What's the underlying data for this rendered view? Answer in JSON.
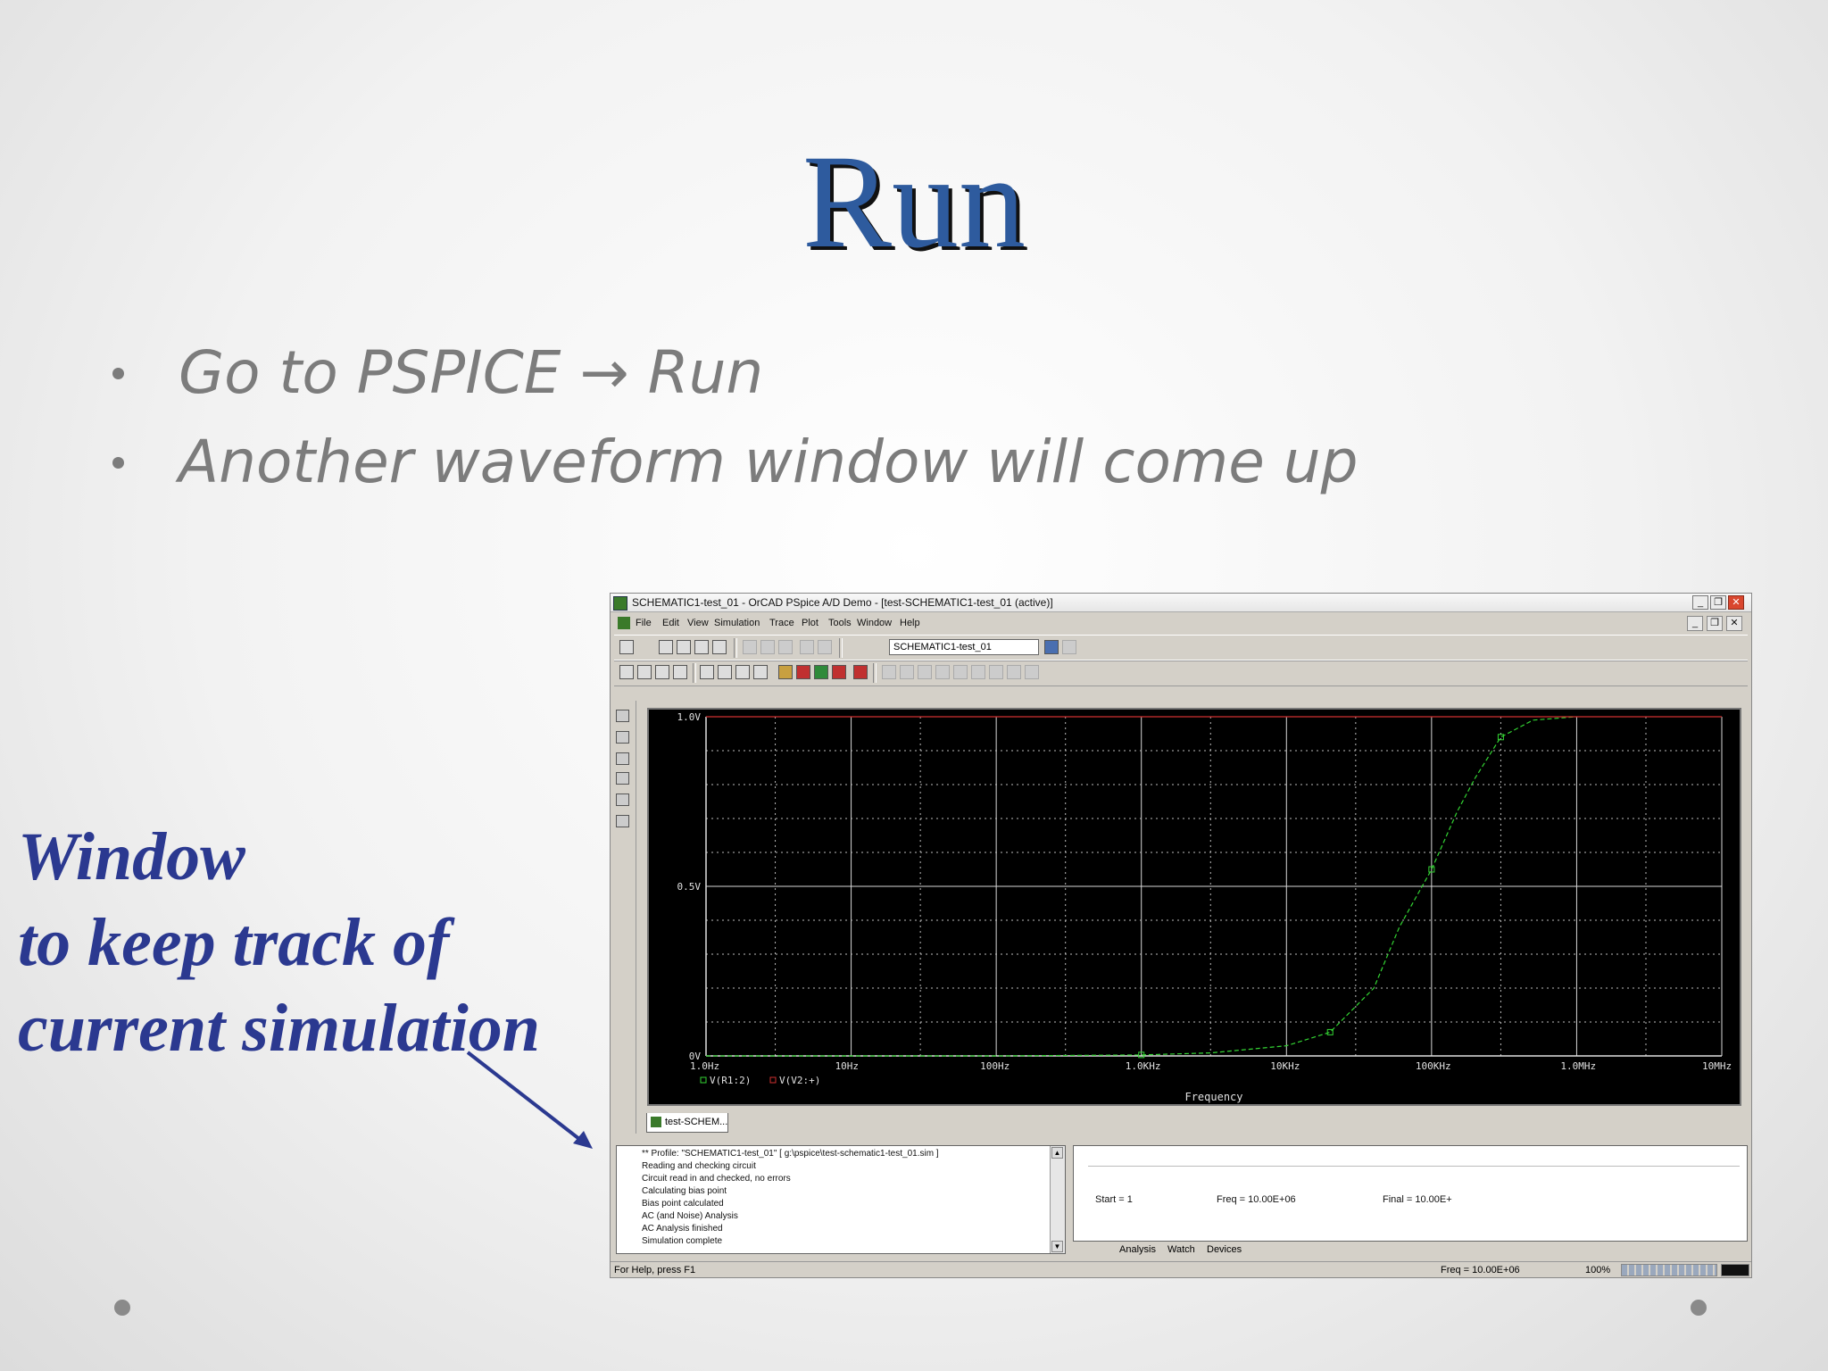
{
  "slide": {
    "title": "Run",
    "bullets": [
      "Go to PSPICE → Run",
      "Another waveform window will come up"
    ],
    "callout_lines": [
      "Window",
      "to keep track of",
      "current simulation"
    ]
  },
  "window": {
    "title": "SCHEMATIC1-test_01 - OrCAD PSpice A/D Demo - [test-SCHEMATIC1-test_01 (active)]",
    "menu": [
      "File",
      "Edit",
      "View",
      "Simulation",
      "Trace",
      "Plot",
      "Tools",
      "Window",
      "Help"
    ],
    "profile_select": "SCHEMATIC1-test_01",
    "doc_tab": "test-SCHEM...",
    "output_lines": [
      "** Profile: \"SCHEMATIC1-test_01\"  [ g:\\pspice\\test-schematic1-test_01.sim ]",
      "Reading and checking circuit",
      "Circuit read in and checked, no errors",
      "Calculating bias point",
      "Bias point calculated",
      "AC (and Noise) Analysis",
      "AC Analysis finished",
      "Simulation complete"
    ],
    "sim_status": {
      "start": "Start = 1",
      "freq": "Freq = 10.00E+06",
      "final": "Final = 10.00E+"
    },
    "sim_tabs": [
      "Analysis",
      "Watch",
      "Devices"
    ],
    "status": {
      "help": "For Help, press F1",
      "freq": "Freq = 10.00E+06",
      "percent": "100%"
    }
  },
  "chart_data": {
    "type": "line",
    "xscale": "log",
    "x_ticks": [
      "1.0Hz",
      "10Hz",
      "100Hz",
      "1.0KHz",
      "10KHz",
      "100KHz",
      "1.0MHz",
      "10MHz"
    ],
    "y_ticks": [
      "0V",
      "0.5V",
      "1.0V"
    ],
    "xlabel": "Frequency",
    "xlim": [
      1,
      10000000
    ],
    "ylim": [
      0,
      1
    ],
    "series": [
      {
        "name": "V(R1:2)",
        "color": "#33d433",
        "x": [
          1,
          10,
          100,
          1000,
          3000,
          10000,
          20000,
          40000,
          60000,
          100000,
          150000,
          200000,
          300000,
          500000,
          1000000
        ],
        "y": [
          0.0,
          0.0,
          0.0,
          0.003,
          0.009,
          0.03,
          0.07,
          0.2,
          0.38,
          0.55,
          0.72,
          0.82,
          0.94,
          0.99,
          1.0
        ]
      },
      {
        "name": "V(V2:+)",
        "color": "#d03030",
        "x": [
          1,
          10000000
        ],
        "y": [
          1.0,
          1.0
        ]
      }
    ]
  }
}
